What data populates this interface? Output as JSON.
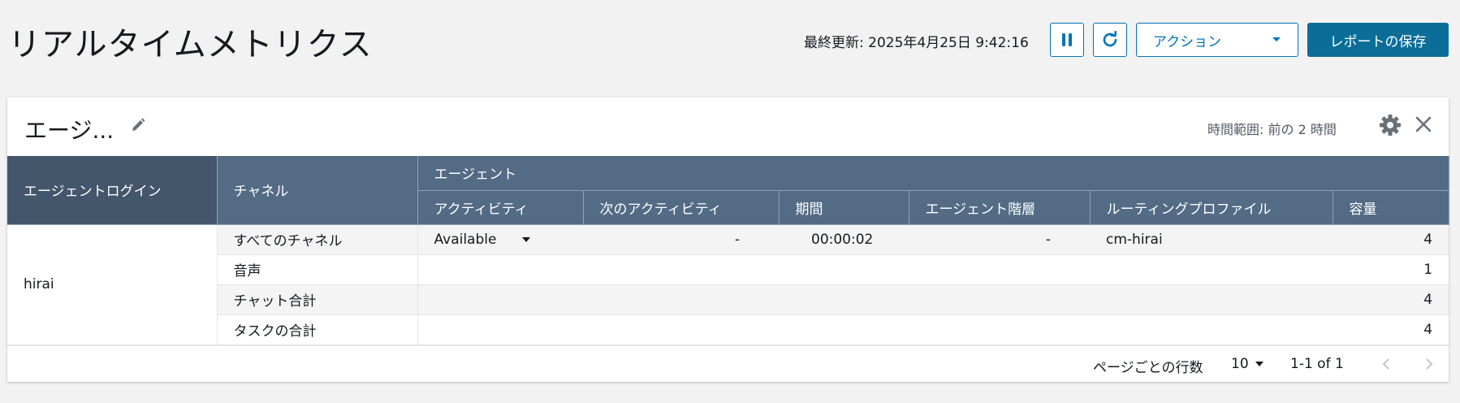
{
  "header": {
    "title": "リアルタイムメトリクス",
    "last_updated": "最終更新: 2025年4月25日 9:42:16",
    "action_label": "アクション",
    "save_label": "レポートの保存"
  },
  "widget": {
    "title": "エージ...",
    "time_range": "時間範囲: 前の 2 時間"
  },
  "table": {
    "col_login": "エージェントログイン",
    "col_channel": "チャネル",
    "group_agent": "エージェント",
    "col_activity": "アクティビティ",
    "col_next_activity": "次のアクティビティ",
    "col_duration": "期間",
    "col_hierarchy": "エージェント階層",
    "col_routing": "ルーティングプロファイル",
    "col_capacity": "容量",
    "login": "hirai",
    "rows": [
      {
        "channel": "すべてのチャネル",
        "activity": "Available",
        "next_activity": "-",
        "duration": "00:00:02",
        "hierarchy": "-",
        "routing": "cm-hirai",
        "capacity": "4"
      },
      {
        "channel": "音声",
        "capacity": "1"
      },
      {
        "channel": "チャット合計",
        "capacity": "4"
      },
      {
        "channel": "タスクの合計",
        "capacity": "4"
      }
    ]
  },
  "pagination": {
    "rows_per_page_label": "ページごとの行数",
    "rows_per_page": "10",
    "range": "1-1 of 1"
  },
  "colors": {
    "accent": "#0073bb",
    "save_bg": "#0a6e99",
    "header_bg": "#536b85",
    "header_dark_bg": "#44566b"
  }
}
